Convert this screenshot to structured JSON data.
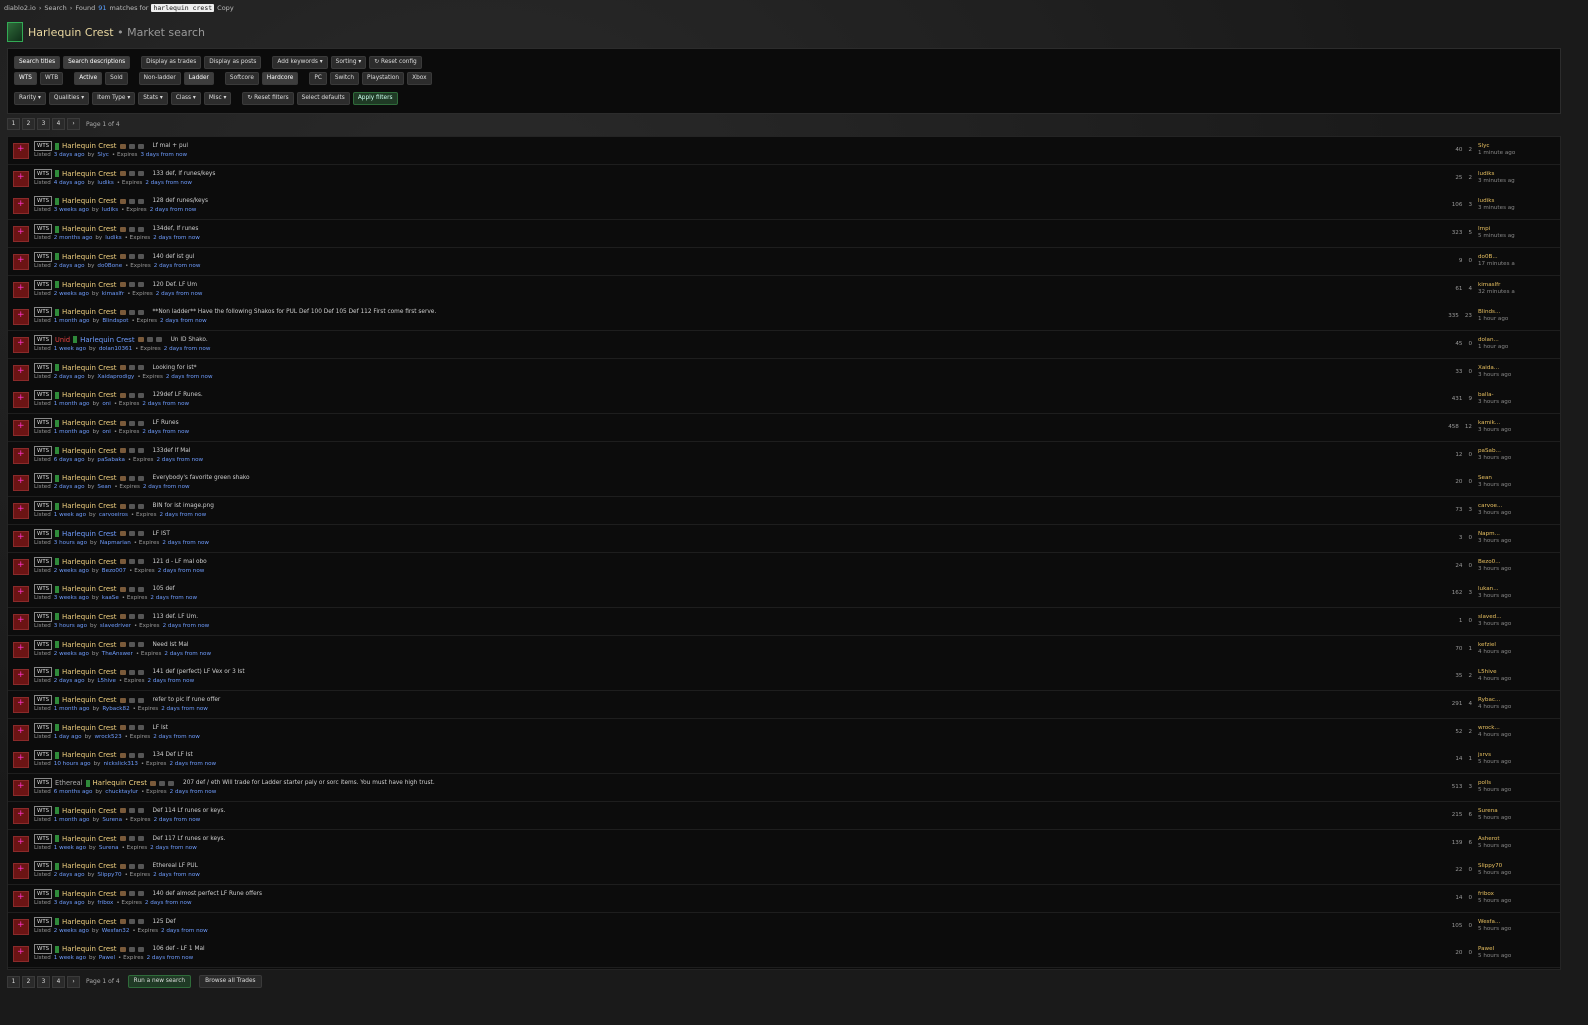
{
  "breadcrumb": {
    "site": "diablo2.io",
    "sep": "›",
    "search": "Search",
    "found_prefix": "Found",
    "count": "91",
    "found_suffix": "matches for",
    "query": "harlequin crest",
    "copy": "Copy"
  },
  "header": {
    "title": "Harlequin Crest",
    "subtitle": "• Market search"
  },
  "filters": {
    "row1": [
      "Search titles",
      "Search descriptions",
      "Display as trades",
      "Display as posts",
      "Add keywords ▾",
      "Sorting ▾",
      "↻ Reset config"
    ],
    "row2": [
      "WTS",
      "WTB",
      "Active",
      "Sold",
      "Non-ladder",
      "Ladder",
      "Softcore",
      "Hardcore",
      "PC",
      "Switch",
      "Playstation",
      "Xbox"
    ],
    "row3": [
      "Rarity ▾",
      "Qualities ▾",
      "Item Type ▾",
      "Stats ▾",
      "Class ▾",
      "Misc ▾",
      "↻ Reset filters",
      "Select defaults",
      "Apply filters"
    ]
  },
  "pager": {
    "pages": [
      "1",
      "2",
      "3",
      "4",
      "›"
    ],
    "info": "Page 1 of 4"
  },
  "bottom": {
    "new_search": "Run a new search",
    "browse": "Browse all Trades"
  },
  "listings": [
    {
      "type": "WTS",
      "item": "Harlequin Crest",
      "msg": "Lf mal + pul",
      "listed": "3 days ago",
      "user": "Slyc",
      "expires": "3 days from now",
      "views": "40",
      "replies": "2",
      "last_user": "Slyc",
      "last_time": "1 minute ago"
    },
    {
      "type": "WTS",
      "item": "Harlequin Crest",
      "msg": "133 def, lf runes/keys",
      "listed": "4 days ago",
      "user": "ludiks",
      "expires": "2 days from now",
      "views": "25",
      "replies": "2",
      "last_user": "ludiks",
      "last_time": "3 minutes ag"
    },
    {
      "type": "WTS",
      "item": "Harlequin Crest",
      "msg": "128 def runes/keys",
      "listed": "3 weeks ago",
      "user": "ludiks",
      "expires": "2 days from now",
      "views": "106",
      "replies": "3",
      "last_user": "ludiks",
      "last_time": "3 minutes ag"
    },
    {
      "type": "WTS",
      "item": "Harlequin Crest",
      "msg": "134def, lf runes",
      "listed": "2 months ago",
      "user": "ludiks",
      "expires": "2 days from now",
      "views": "323",
      "replies": "5",
      "last_user": "Impi",
      "last_time": "5 minutes ag"
    },
    {
      "type": "WTS",
      "item": "Harlequin Crest",
      "msg": "140 def ist gul",
      "listed": "2 days ago",
      "user": "do0Bone",
      "expires": "2 days from now",
      "views": "9",
      "replies": "0",
      "last_user": "do0B...",
      "last_time": "17 minutes a"
    },
    {
      "type": "WTS",
      "item": "Harlequin Crest",
      "msg": "120 Def. LF Um",
      "listed": "2 weeks ago",
      "user": "kimaslfr",
      "expires": "2 days from now",
      "views": "61",
      "replies": "4",
      "last_user": "kimaslfr",
      "last_time": "32 minutes a"
    },
    {
      "type": "WTS",
      "item": "Harlequin Crest",
      "msg": "**Non ladder** Have the following Shakos for PUL Def 100 Def 105 Def 112 First come first serve.",
      "listed": "1 month ago",
      "user": "Blindspot",
      "expires": "2 days from now",
      "views": "335",
      "replies": "23",
      "last_user": "Blinds...",
      "last_time": "1 hour ago"
    },
    {
      "type": "WTS",
      "tag": "Unid",
      "item": "Harlequin Crest",
      "blue": true,
      "msg": "Un ID Shako.",
      "listed": "1 week ago",
      "user": "dolan10361",
      "expires": "2 days from now",
      "views": "45",
      "replies": "0",
      "last_user": "dolan...",
      "last_time": "1 hour ago"
    },
    {
      "type": "WTS",
      "item": "Harlequin Crest",
      "msg": "Looking for ist*",
      "listed": "2 days ago",
      "user": "Xaidaprodigy",
      "expires": "2 days from now",
      "views": "33",
      "replies": "0",
      "last_user": "Xaida...",
      "last_time": "3 hours ago"
    },
    {
      "type": "WTS",
      "item": "Harlequin Crest",
      "msg": "129def LF Runes.",
      "listed": "1 month ago",
      "user": "oni",
      "expires": "2 days from now",
      "views": "431",
      "replies": "9",
      "last_user": "balla-",
      "last_time": "3 hours ago"
    },
    {
      "type": "WTS",
      "item": "Harlequin Crest",
      "msg": "LF Runes",
      "listed": "1 month ago",
      "user": "oni",
      "expires": "2 days from now",
      "views": "458",
      "replies": "12",
      "last_user": "kamik...",
      "last_time": "3 hours ago"
    },
    {
      "type": "WTS",
      "item": "Harlequin Crest",
      "msg": "133def lf Mal",
      "listed": "6 days ago",
      "user": "paSabaka",
      "expires": "2 days from now",
      "views": "12",
      "replies": "0",
      "last_user": "paSab...",
      "last_time": "3 hours ago"
    },
    {
      "type": "WTS",
      "item": "Harlequin Crest",
      "msg": "Everybody's favorite green shako",
      "listed": "2 days ago",
      "user": "Sean",
      "expires": "2 days from now",
      "views": "20",
      "replies": "0",
      "last_user": "Sean",
      "last_time": "3 hours ago"
    },
    {
      "type": "WTS",
      "item": "Harlequin Crest",
      "msg": "BIN for ist image.png",
      "listed": "1 week ago",
      "user": "carvoeiros",
      "expires": "2 days from now",
      "views": "73",
      "replies": "3",
      "last_user": "carvoe...",
      "last_time": "3 hours ago"
    },
    {
      "type": "WTS",
      "item": "Harlequin Crest",
      "blue": true,
      "msg": "LF IST",
      "listed": "3 hours ago",
      "user": "Napmarian",
      "expires": "2 days from now",
      "views": "3",
      "replies": "0",
      "last_user": "Napm...",
      "last_time": "3 hours ago"
    },
    {
      "type": "WTS",
      "item": "Harlequin Crest",
      "msg": "121 d - LF mal obo",
      "listed": "2 weeks ago",
      "user": "Bezo007",
      "expires": "2 days from now",
      "views": "24",
      "replies": "0",
      "last_user": "Bezo0...",
      "last_time": "3 hours ago"
    },
    {
      "type": "WTS",
      "item": "Harlequin Crest",
      "msg": "105 def",
      "listed": "3 weeks ago",
      "user": "kaaSe",
      "expires": "2 days from now",
      "views": "162",
      "replies": "3",
      "last_user": "lukan...",
      "last_time": "3 hours ago"
    },
    {
      "type": "WTS",
      "item": "Harlequin Crest",
      "msg": "113 def. LF Um.",
      "listed": "3 hours ago",
      "user": "slavedriver",
      "expires": "2 days from now",
      "views": "1",
      "replies": "0",
      "last_user": "slaved...",
      "last_time": "3 hours ago"
    },
    {
      "type": "WTS",
      "item": "Harlequin Crest",
      "msg": "Need Ist Mal",
      "listed": "2 weeks ago",
      "user": "TheAnswer",
      "expires": "2 days from now",
      "views": "70",
      "replies": "1",
      "last_user": "kefziel",
      "last_time": "4 hours ago"
    },
    {
      "type": "WTS",
      "item": "Harlequin Crest",
      "msg": "141 def (perfect) LF Vex or 3 Ist",
      "listed": "2 days ago",
      "user": "L5hive",
      "expires": "2 days from now",
      "views": "35",
      "replies": "2",
      "last_user": "L5hive",
      "last_time": "4 hours ago"
    },
    {
      "type": "WTS",
      "item": "Harlequin Crest",
      "msg": "refer to pic lf rune offer",
      "listed": "1 month ago",
      "user": "Ryback82",
      "expires": "2 days from now",
      "views": "291",
      "replies": "4",
      "last_user": "Rybac...",
      "last_time": "4 hours ago"
    },
    {
      "type": "WTS",
      "item": "Harlequin Crest",
      "msg": "LF Ist",
      "listed": "1 day ago",
      "user": "wrock523",
      "expires": "2 days from now",
      "views": "52",
      "replies": "2",
      "last_user": "wrock...",
      "last_time": "4 hours ago"
    },
    {
      "type": "WTS",
      "item": "Harlequin Crest",
      "msg": "134 Def LF Ist",
      "listed": "10 hours ago",
      "user": "nickslick313",
      "expires": "2 days from now",
      "views": "14",
      "replies": "1",
      "last_user": "jsrvs",
      "last_time": "5 hours ago"
    },
    {
      "type": "WTS",
      "tag": "Ethereal",
      "item": "Harlequin Crest",
      "msg": "207 def / eth Will trade for Ladder starter paly or sorc items. You must have high trust.",
      "listed": "6 months ago",
      "user": "chucktaylur",
      "expires": "2 days from now",
      "views": "513",
      "replies": "3",
      "last_user": "polls",
      "last_time": "5 hours ago"
    },
    {
      "type": "WTS",
      "item": "Harlequin Crest",
      "msg": "Def 114 Lf runes or keys.",
      "listed": "1 month ago",
      "user": "Surena",
      "expires": "2 days from now",
      "views": "215",
      "replies": "6",
      "last_user": "Surena",
      "last_time": "5 hours ago"
    },
    {
      "type": "WTS",
      "item": "Harlequin Crest",
      "msg": "Def 117 Lf runes or keys.",
      "listed": "1 week ago",
      "user": "Surena",
      "expires": "2 days from now",
      "views": "139",
      "replies": "6",
      "last_user": "Asherot",
      "last_time": "5 hours ago"
    },
    {
      "type": "WTS",
      "item": "Harlequin Crest",
      "msg": "Ethereal LF PUL",
      "listed": "2 days ago",
      "user": "Slippy70",
      "expires": "2 days from now",
      "views": "22",
      "replies": "0",
      "last_user": "Slippy70",
      "last_time": "5 hours ago"
    },
    {
      "type": "WTS",
      "item": "Harlequin Crest",
      "msg": "140 def almost perfect LF Rune offers",
      "listed": "3 days ago",
      "user": "fribox",
      "expires": "2 days from now",
      "views": "14",
      "replies": "0",
      "last_user": "fribox",
      "last_time": "5 hours ago"
    },
    {
      "type": "WTS",
      "item": "Harlequin Crest",
      "msg": "125 Def",
      "listed": "2 weeks ago",
      "user": "Wesfan32",
      "expires": "2 days from now",
      "views": "105",
      "replies": "0",
      "last_user": "Wesfa...",
      "last_time": "5 hours ago"
    },
    {
      "type": "WTS",
      "item": "Harlequin Crest",
      "msg": "106 def - LF 1 Mal",
      "listed": "1 week ago",
      "user": "Pawel",
      "expires": "2 days from now",
      "views": "20",
      "replies": "0",
      "last_user": "Pawel",
      "last_time": "5 hours ago"
    }
  ]
}
